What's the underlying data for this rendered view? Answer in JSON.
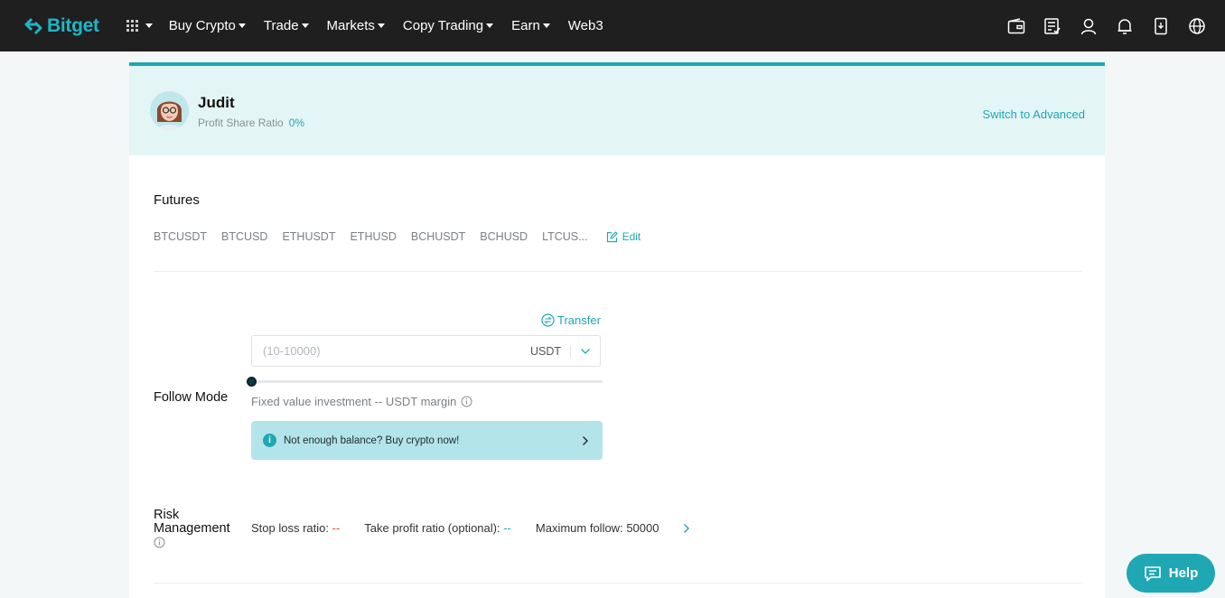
{
  "header": {
    "logo_text": "Bitget",
    "nav": [
      {
        "label": "Buy Crypto",
        "has_caret": true
      },
      {
        "label": "Trade",
        "has_caret": true
      },
      {
        "label": "Markets",
        "has_caret": true
      },
      {
        "label": "Copy Trading",
        "has_caret": true
      },
      {
        "label": "Earn",
        "has_caret": true
      },
      {
        "label": "Web3",
        "has_caret": false
      }
    ],
    "right_icons": [
      "wallet-icon",
      "orders-icon",
      "user-icon",
      "bell-icon",
      "download-icon",
      "globe-icon"
    ]
  },
  "profile": {
    "name": "Judit",
    "share_label": "Profit Share Ratio",
    "share_value": "0%",
    "switch_label": "Switch to Advanced"
  },
  "futures": {
    "title": "Futures",
    "pairs": [
      "BTCUSDT",
      "BTCUSD",
      "ETHUSDT",
      "ETHUSD",
      "BCHUSDT",
      "BCHUSD",
      "LTCUS..."
    ],
    "edit_label": "Edit"
  },
  "follow_mode": {
    "label": "Follow Mode",
    "transfer_label": "Transfer",
    "amount_placeholder": "(10-10000)",
    "unit": "USDT",
    "slider_value_percent": 0,
    "description": "Fixed value investment -- USDT margin",
    "banner_text": "Not enough balance? Buy crypto now!"
  },
  "risk": {
    "label_line1": "Risk",
    "label_line2": "Management",
    "stop_loss_label": "Stop loss ratio:",
    "stop_loss_value": "--",
    "take_profit_label": "Take profit ratio (optional):",
    "take_profit_value": "--",
    "max_follow_label": "Maximum follow:",
    "max_follow_value": "50000"
  },
  "help": {
    "label": "Help"
  },
  "colors": {
    "accent": "#1fa7b3",
    "nav_bg": "#1f1f20",
    "profile_bg": "#e4f5f5",
    "banner_bg": "#b3e4ea",
    "danger": "#e2483d"
  }
}
